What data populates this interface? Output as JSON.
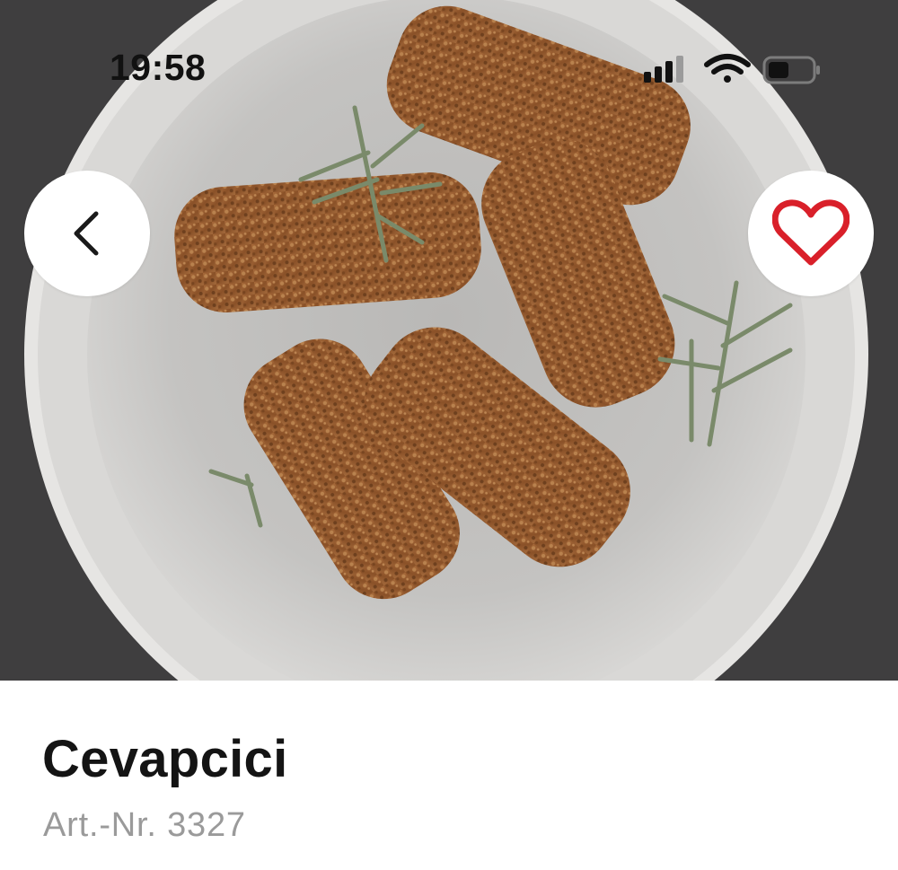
{
  "status_bar": {
    "time": "19:58",
    "icons": [
      "cellular-signal-icon",
      "wifi-icon",
      "battery-icon"
    ]
  },
  "hero": {
    "image": "product-photo-cevapcici-plate",
    "back_icon": "chevron-left-icon",
    "favorite_icon": "heart-outline-icon",
    "favorite_color": "#d9202a"
  },
  "product": {
    "title": "Cevapcici",
    "article_number": "Art.-Nr. 3327"
  }
}
